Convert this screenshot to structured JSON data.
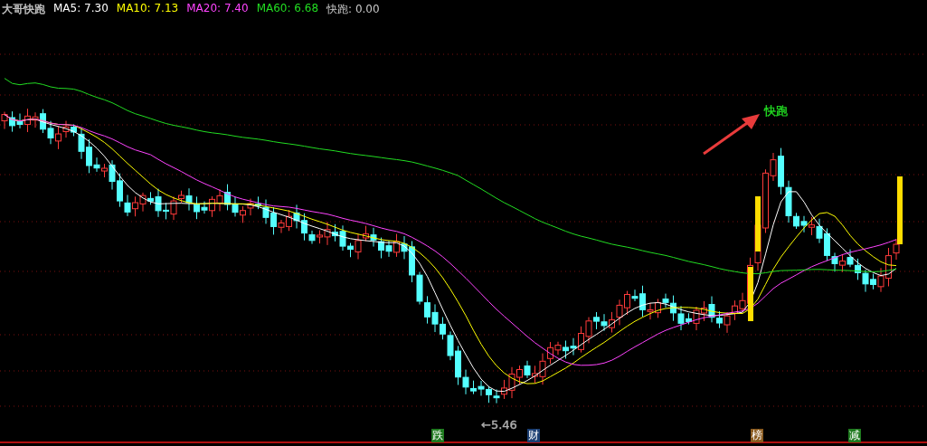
{
  "legend": [
    {
      "text": "大哥快跑",
      "color": "#c8c8c8"
    },
    {
      "text": "MA5: 7.30",
      "color": "#ffffff"
    },
    {
      "text": "MA10: 7.13",
      "color": "#ffff00"
    },
    {
      "text": "MA20: 7.40",
      "color": "#ff44ff"
    },
    {
      "text": "MA60: 6.68",
      "color": "#22dd22"
    },
    {
      "text": "快跑: 0.00",
      "color": "#c8c8c8"
    }
  ],
  "annotation": {
    "text": "快跑",
    "color": "#22dd22"
  },
  "low_marker": "←5.46",
  "signal_tags": [
    {
      "label": "跌",
      "color": "#1f7a1f"
    },
    {
      "label": "财",
      "color": "#1c3f73"
    },
    {
      "label": "榜",
      "color": "#8a5a1e"
    },
    {
      "label": "减",
      "color": "#1f7a1f"
    }
  ]
}
